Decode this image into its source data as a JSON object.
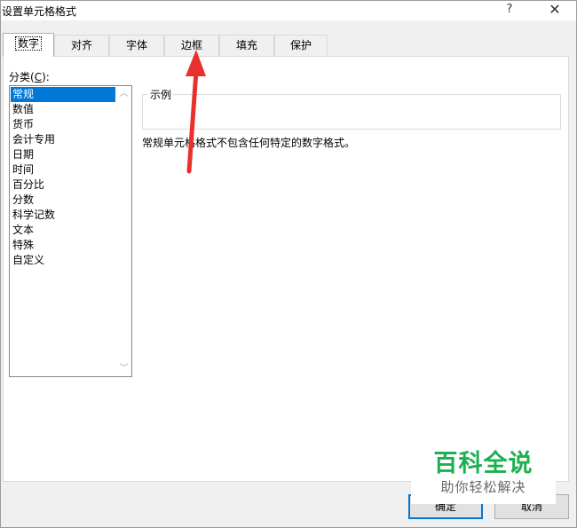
{
  "window": {
    "title": "设置单元格格式",
    "help_glyph": "?",
    "close_glyph": "✕"
  },
  "tabs": [
    {
      "label": "数字",
      "active": true
    },
    {
      "label": "对齐",
      "active": false
    },
    {
      "label": "字体",
      "active": false
    },
    {
      "label": "边框",
      "active": false
    },
    {
      "label": "填充",
      "active": false
    },
    {
      "label": "保护",
      "active": false
    }
  ],
  "category": {
    "label_prefix": "分类(",
    "label_key": "C",
    "label_suffix": "):",
    "items": [
      "常规",
      "数值",
      "货币",
      "会计专用",
      "日期",
      "时间",
      "百分比",
      "分数",
      "科学记数",
      "文本",
      "特殊",
      "自定义"
    ],
    "selected": "常规"
  },
  "sample": {
    "legend": "示例",
    "value": ""
  },
  "description": "常规单元格格式不包含任何特定的数字格式。",
  "buttons": {
    "ok": "确定",
    "cancel": "取消"
  },
  "annotation": {
    "color": "#e8312c"
  },
  "watermark": {
    "main": "百科全说",
    "sub": "助你轻松解决",
    "color": "#1db050"
  }
}
